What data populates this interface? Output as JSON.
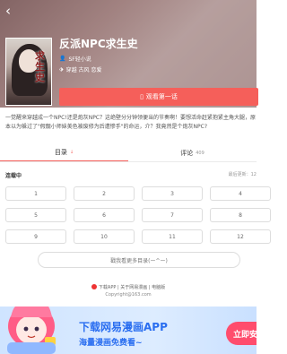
{
  "header": {
    "back_icon": "chevron-left-icon",
    "title": "反派NPC求生史",
    "author": "SF轻小说",
    "tags": "穿越 古风 恋爱",
    "cover_text": "求生史"
  },
  "actions": {
    "read_button": "观看第一话"
  },
  "description": "一觉醒来穿越成一个NPC!还是炮灰NPC？这绝壁分分钟领便当的节奏啊！要想活命赶紧抱紧主角大腿，原本以为躲过了\"假靓小师妹美色被废修为后遭惨手\"的命运，介？我竟然是个炮灰NPC?",
  "tabs": [
    {
      "label": "目录",
      "arrow": "↓"
    },
    {
      "label": "评论",
      "count": "409"
    }
  ],
  "chapter_section": {
    "status": "连载中",
    "update": "最后更新：12"
  },
  "chapters": [
    "1",
    "2",
    "3",
    "4",
    "5",
    "6",
    "7",
    "8",
    "9",
    "10",
    "11",
    "12"
  ],
  "more_button": "戳我看更多目录(ー^ー)",
  "footer": {
    "links": "下载APP | 关于网易漫画 | 电脑版",
    "copyright": "Copyright@163.com"
  },
  "banner": {
    "title": "下载网易漫画APP",
    "subtitle": "海量漫画免费看~",
    "install_button": "立即安装"
  },
  "colors": {
    "accent": "#f55f5a",
    "banner_text": "#2a6ef0",
    "install_button": "#ff4d6d"
  }
}
